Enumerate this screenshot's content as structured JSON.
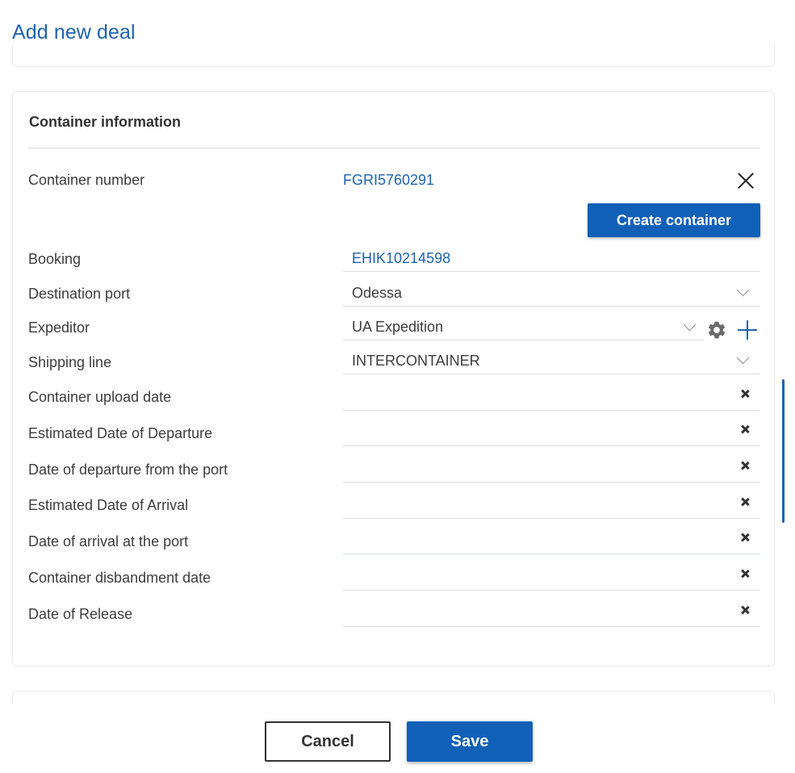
{
  "header": {
    "title": "Add new deal"
  },
  "container_section": {
    "title": "Container information",
    "container_number": {
      "label": "Container number",
      "value": "FGRI5760291"
    },
    "create_button": "Create container",
    "booking": {
      "label": "Booking",
      "value": "EHIK10214598"
    },
    "destination_port": {
      "label": "Destination port",
      "value": "Odessa"
    },
    "expeditor": {
      "label": "Expeditor",
      "value": "UA Expedition"
    },
    "shipping_line": {
      "label": "Shipping line",
      "value": "INTERCONTAINER"
    },
    "dates": [
      {
        "label": "Container upload date",
        "value": ""
      },
      {
        "label": "Estimated Date of Departure",
        "value": ""
      },
      {
        "label": "Date of departure from the port",
        "value": ""
      },
      {
        "label": "Estimated Date of Arrival",
        "value": ""
      },
      {
        "label": "Date of arrival at the port",
        "value": ""
      },
      {
        "label": "Container disbandment date",
        "value": ""
      },
      {
        "label": "Date of Release",
        "value": ""
      }
    ]
  },
  "footer": {
    "cancel_label": "Cancel",
    "save_label": "Save"
  },
  "icons": {
    "close": "close-icon",
    "chevron": "chevron-down-icon",
    "gear": "gear-icon",
    "plus": "plus-icon",
    "clear": "clear-icon"
  },
  "colors": {
    "accent": "#1060b8",
    "link": "#1e63b3",
    "text": "#3d3d3d"
  }
}
